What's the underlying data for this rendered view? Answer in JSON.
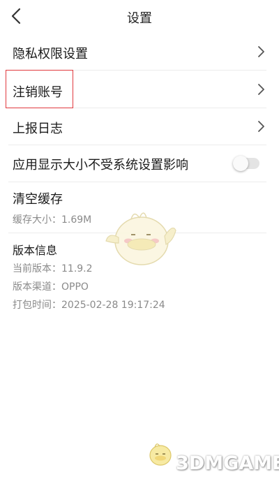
{
  "header": {
    "title": "设置"
  },
  "rows": {
    "privacy": "隐私权限设置",
    "cancel_account": "注销账号",
    "report_log": "上报日志",
    "display_size": "应用显示大小不受系统设置影响",
    "clear_cache": "清空缓存"
  },
  "cache": {
    "size_text": "缓存大小：1.69M"
  },
  "version_info": {
    "title": "版本信息",
    "current_version": "当前版本：11.9.2",
    "channel": "版本渠道：OPPO",
    "build_time": "打包时间：2025-02-28 19:17:24"
  },
  "toggle": {
    "display_size_enabled": false
  },
  "watermark": {
    "text": "3DMGAME"
  },
  "colors": {
    "highlight": "#e0393e",
    "divider": "#ececec",
    "secondary_text": "#8a8a8a"
  }
}
